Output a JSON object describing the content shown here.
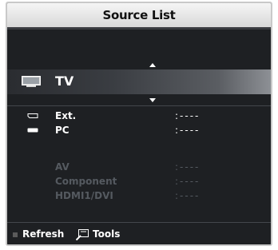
{
  "window": {
    "title": "Source List"
  },
  "selected": {
    "label": "TV",
    "icon": "tv-icon"
  },
  "sources": [
    {
      "label": "Ext.",
      "value": ":----",
      "icon": "scart-icon",
      "enabled": true
    },
    {
      "label": "PC",
      "value": ":----",
      "icon": "pc-icon",
      "enabled": true
    },
    {
      "label": "AV",
      "value": ":----",
      "enabled": false
    },
    {
      "label": "Component",
      "value": ":----",
      "enabled": false
    },
    {
      "label": "HDMI1/DVI",
      "value": ":----",
      "enabled": false
    }
  ],
  "footer": {
    "refresh_label": "Refresh",
    "tools_label": "Tools",
    "tools_icon": "tools-icon"
  }
}
